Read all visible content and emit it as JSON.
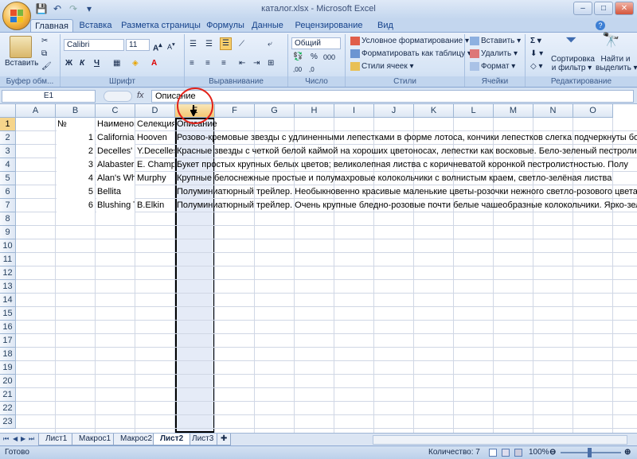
{
  "window": {
    "title": "каталог.xlsx - Microsoft Excel",
    "controls": [
      "–",
      "□",
      "✕"
    ]
  },
  "ribbon_tabs": [
    "Главная",
    "Вставка",
    "Разметка страницы",
    "Формулы",
    "Данные",
    "Рецензирование",
    "Вид"
  ],
  "ribbon": {
    "clipboard": {
      "label": "Буфер обм...",
      "paste": "Вставить"
    },
    "font": {
      "label": "Шрифт",
      "name": "Calibri",
      "size": "11"
    },
    "alignment": {
      "label": "Выравнивание"
    },
    "number": {
      "label": "Число",
      "format": "Общий"
    },
    "styles": {
      "label": "Стили",
      "conditional": "Условное форматирование",
      "as_table": "Форматировать как таблицу",
      "cell_styles": "Стили ячеек"
    },
    "cells": {
      "label": "Ячейки",
      "insert": "Вставить",
      "delete": "Удалить",
      "format": "Формат"
    },
    "editing": {
      "label": "Редактирование",
      "sort": "Сортировка",
      "sort2": "и фильтр",
      "find": "Найти и",
      "find2": "выделить"
    }
  },
  "formula_bar": {
    "cell": "E1",
    "fx": "fx",
    "value": "Описание"
  },
  "columns": [
    "A",
    "B",
    "C",
    "D",
    "E",
    "F",
    "G",
    "H",
    "I",
    "J",
    "K",
    "L",
    "M",
    "N",
    "O"
  ],
  "selected_column": "E",
  "selected_row": "1",
  "rows": [
    "1",
    "2",
    "3",
    "4",
    "5",
    "6",
    "7",
    "8",
    "9",
    "10",
    "11",
    "12",
    "13",
    "14",
    "15",
    "16",
    "17",
    "18",
    "19",
    "20",
    "21",
    "22",
    "23"
  ],
  "cells": {
    "b1": "№",
    "c1": "Наименов",
    "d1": "Селекция",
    "e1": "Описание",
    "b2": "1",
    "c2": "California",
    "d2": "Hooven",
    "e2": "Розово-кремовые звезды с удлиненными лепестками в форме лотоса, кончики лепестков слегка подчеркнуты бо",
    "b3": "2",
    "c3": "Decelles'",
    "d3": "Y.Decelles",
    "e3": "Красные звезды с четкой белой каймой на хороших цветоносах, лепестки как восковые. Бело-зеленый пестроли",
    "b4": "3",
    "c4": "Alabaster",
    "d4": "E. Champi",
    "e4": "Букет простых крупных белых цветов; великолепная листва с коричневатой коронкой пестролистностью. Полу",
    "b5": "4",
    "c5": "Alan's Wh",
    "d5": "Murphy",
    "e5": "Крупные белоснежные простые и полумахровые колокольчики с волнистым краем, светло-зелёная листва",
    "b6": "5",
    "c6": "Bellita",
    "d6": "",
    "e6": "Полуминиатюрный трейлер. Необыкновенно красивые маленькие цветы-розочки нежного светло-розового цвета с зелен",
    "b7": "6",
    "c7": "Blushing T",
    "d7": "B.Elkin",
    "e7": "Полуминиатюрный трейлер. Очень крупные бледно-розовые почти белые чашеобразные колокольчики. Ярко-зеленая за"
  },
  "sheet_tabs": [
    "Лист1",
    "Макрос1",
    "Макрос2",
    "Лист2",
    "Лист3"
  ],
  "active_sheet": "Лист2",
  "status": {
    "ready": "Готово",
    "count": "Количество: 7",
    "zoom": "100%"
  }
}
